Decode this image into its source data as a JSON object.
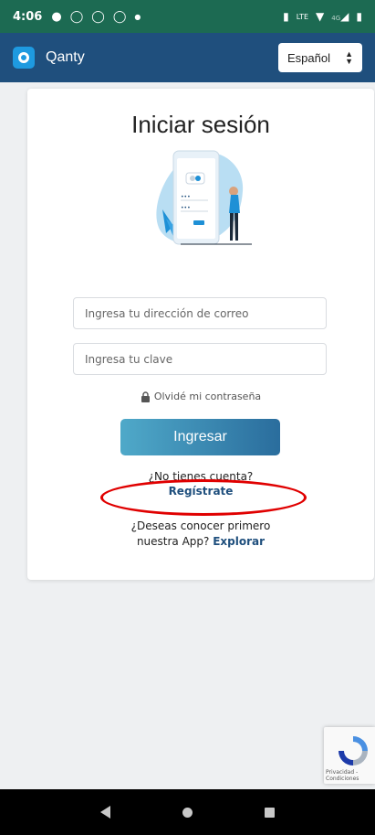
{
  "status_bar": {
    "time": "4:06",
    "left_icons": [
      "chat-icon",
      "whatsapp-icon",
      "facebook-icon",
      "facebook-icon",
      "dot-icon"
    ],
    "right_icons": [
      "vibrate-icon",
      "volte-icon",
      "wifi-icon",
      "signal-4g-icon",
      "battery-icon"
    ],
    "network_label": "4G"
  },
  "app_bar": {
    "brand": "Qanty",
    "language": "Español"
  },
  "login": {
    "title": "Iniciar sesión",
    "email_placeholder": "Ingresa tu dirección de correo",
    "password_placeholder": "Ingresa tu clave",
    "forgot_password": "Olvidé mi contraseña",
    "submit": "Ingresar",
    "no_account": "¿No tienes cuenta?",
    "register": "Regístrate",
    "explore_line1": "¿Deseas conocer primero",
    "explore_line2": "nuestra App?",
    "explore_link": "Explorar"
  },
  "recaptcha": {
    "text": "Privacidad - Condiciones"
  },
  "colors": {
    "status_bar": "#1c6a52",
    "app_bar": "#1f4f7d",
    "accent_link": "#1f4f7d",
    "annotation": "#e00000"
  }
}
